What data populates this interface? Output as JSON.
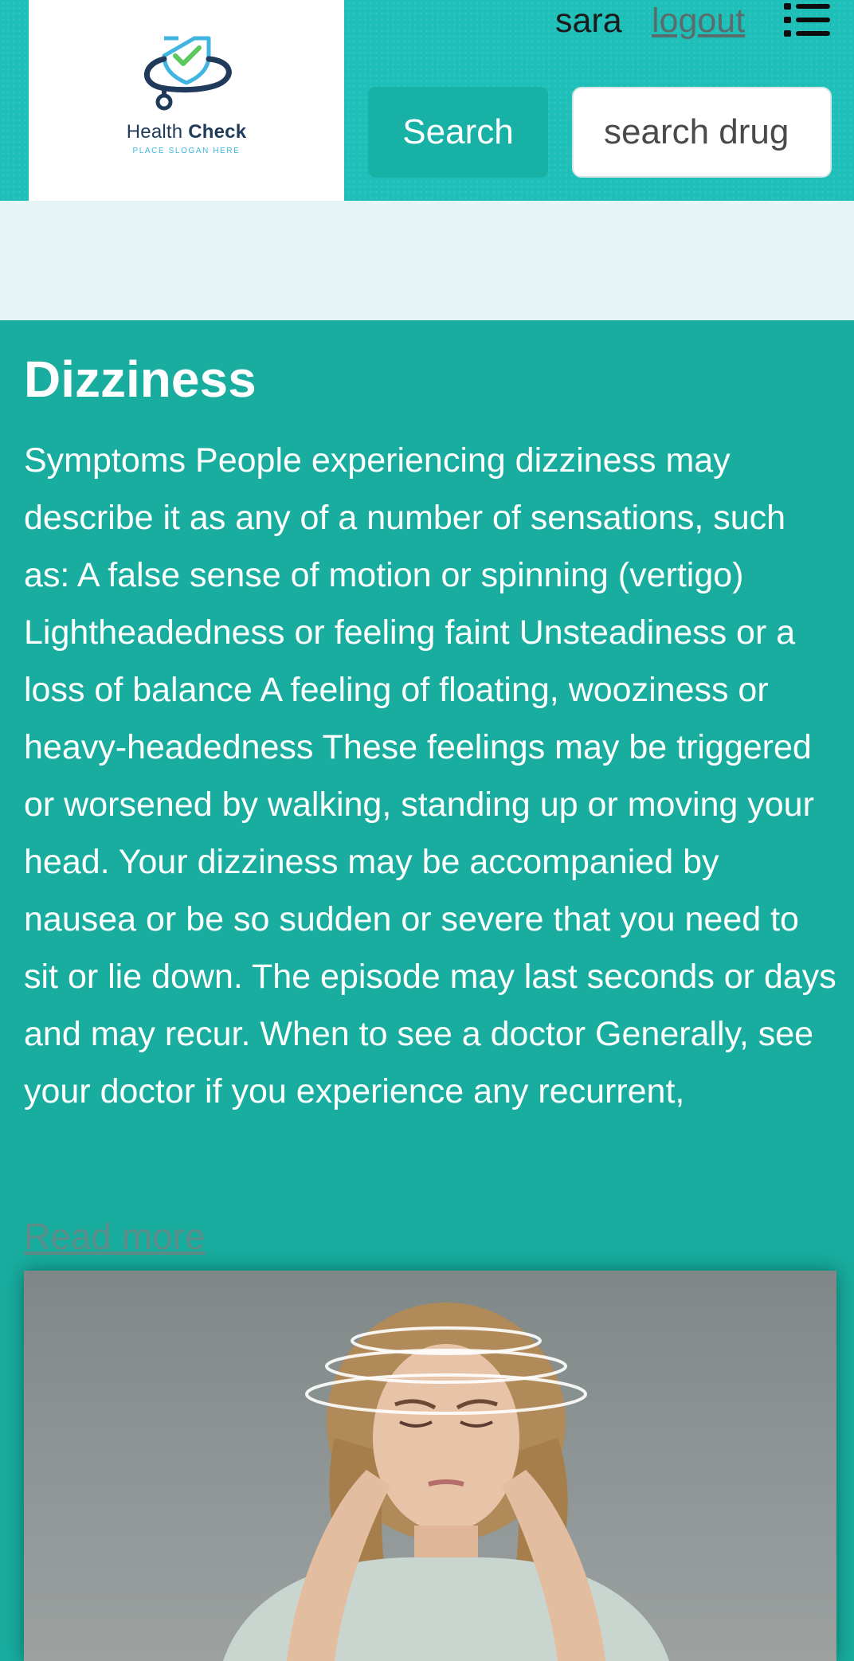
{
  "header": {
    "logo": {
      "name_regular": "Health",
      "name_bold": "Check",
      "slogan": "PLACE SLOGAN HERE",
      "icon": "stethoscope-shield-check-icon"
    },
    "user_name": "sara",
    "logout_label": "logout",
    "menu_icon": "list-menu-icon",
    "search_button_label": "Search",
    "search_placeholder": "search drug"
  },
  "article": {
    "title": "Dizziness",
    "body": "Symptoms People experiencing dizziness may describe it as any of a number of sensations, such as: A false sense of motion or spinning (vertigo) Lightheadedness or feeling faint Unsteadiness or a loss of balance A feeling of floating, wooziness or heavy-headedness These feelings may be triggered or worsened by walking, standing up or moving your head. Your dizziness may be accompanied by nausea or be so sudden or severe that you need to sit or lie down. The episode may last seconds or days and may recur. When to see a doctor Generally, see your doctor if you experience any recurrent,",
    "read_more_label": "Read more",
    "image": "dizzy-woman-photo"
  },
  "colors": {
    "header_teal": "#1dbfb8",
    "article_teal": "#18ad9f",
    "band": "#e6f4f6",
    "logo_navy": "#1f3a5a",
    "logo_check": "#5ac85a",
    "logo_blue": "#3fb5e0"
  }
}
